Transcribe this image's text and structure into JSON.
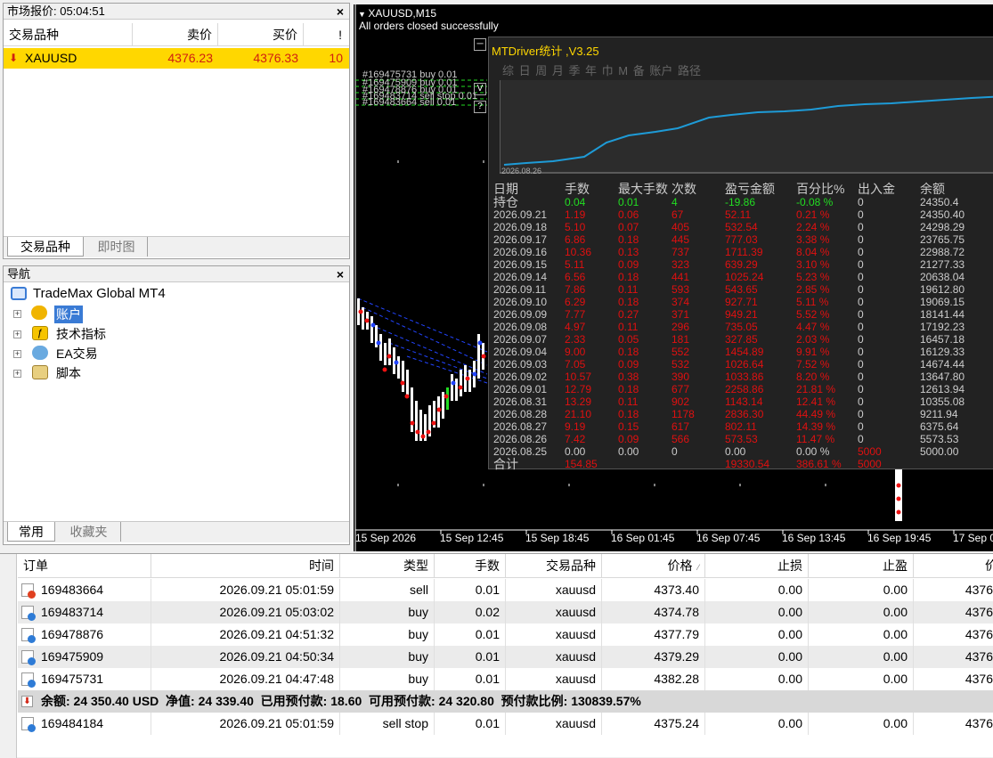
{
  "market_watch": {
    "title": "市场报价: 05:04:51",
    "close": "×",
    "columns": [
      "交易品种",
      "卖价",
      "买价",
      "!"
    ],
    "rows": [
      {
        "symbol": "XAUUSD",
        "bid": "4376.23",
        "ask": "4376.33",
        "spread": "10"
      }
    ],
    "tabs": [
      "交易品种",
      "即时图"
    ]
  },
  "navigator": {
    "title": "导航",
    "close": "×",
    "root": "TradeMax Global MT4",
    "items": [
      "账户",
      "技术指标",
      "EA交易",
      "脚本"
    ],
    "tabs": [
      "常用",
      "收藏夹"
    ]
  },
  "chart": {
    "title": "XAUUSD,M15",
    "message": "All orders closed successfully",
    "order_lines": [
      "#169475731 buy 0.01",
      "#169475909 buy 0.01",
      "#169478876 buy 0.01",
      "#169483714 sell stop 0.01",
      "#169483664 sell 0.01"
    ],
    "x_labels": [
      "15 Sep 2026",
      "15 Sep 12:45",
      "15 Sep 18:45",
      "16 Sep 01:45",
      "16 Sep 07:45",
      "16 Sep 13:45",
      "16 Sep 19:45",
      "17 Sep 0"
    ],
    "side_buttons": [
      "─",
      "V",
      "?"
    ]
  },
  "stats": {
    "title": "MTDriver统计 ,V3.25",
    "tabs": "综 日 周 月 季 年 巾 M 备 账户          路径",
    "graph_date": "2026.08.26",
    "columns": [
      "日期",
      "手数",
      "最大手数",
      "次数",
      "盈亏金额",
      "百分比%",
      "出入金",
      "余额"
    ],
    "holding": {
      "date": "持仓",
      "lots": "0.04",
      "max": "0.01",
      "count": "4",
      "pl": "-19.86",
      "pct": "-0.08 %",
      "io": "0",
      "bal": "24350.4"
    },
    "rows": [
      {
        "date": "2026.09.21",
        "lots": "1.19",
        "max": "0.06",
        "count": "67",
        "pl": "52.11",
        "pct": "0.21 %",
        "io": "0",
        "bal": "24350.40"
      },
      {
        "date": "2026.09.18",
        "lots": "5.10",
        "max": "0.07",
        "count": "405",
        "pl": "532.54",
        "pct": "2.24 %",
        "io": "0",
        "bal": "24298.29"
      },
      {
        "date": "2026.09.17",
        "lots": "6.86",
        "max": "0.18",
        "count": "445",
        "pl": "777.03",
        "pct": "3.38 %",
        "io": "0",
        "bal": "23765.75"
      },
      {
        "date": "2026.09.16",
        "lots": "10.36",
        "max": "0.13",
        "count": "737",
        "pl": "1711.39",
        "pct": "8.04 %",
        "io": "0",
        "bal": "22988.72"
      },
      {
        "date": "2026.09.15",
        "lots": "5.11",
        "max": "0.09",
        "count": "323",
        "pl": "639.29",
        "pct": "3.10 %",
        "io": "0",
        "bal": "21277.33"
      },
      {
        "date": "2026.09.14",
        "lots": "6.56",
        "max": "0.18",
        "count": "441",
        "pl": "1025.24",
        "pct": "5.23 %",
        "io": "0",
        "bal": "20638.04"
      },
      {
        "date": "2026.09.11",
        "lots": "7.86",
        "max": "0.11",
        "count": "593",
        "pl": "543.65",
        "pct": "2.85 %",
        "io": "0",
        "bal": "19612.80"
      },
      {
        "date": "2026.09.10",
        "lots": "6.29",
        "max": "0.18",
        "count": "374",
        "pl": "927.71",
        "pct": "5.11 %",
        "io": "0",
        "bal": "19069.15"
      },
      {
        "date": "2026.09.09",
        "lots": "7.77",
        "max": "0.27",
        "count": "371",
        "pl": "949.21",
        "pct": "5.52 %",
        "io": "0",
        "bal": "18141.44"
      },
      {
        "date": "2026.09.08",
        "lots": "4.97",
        "max": "0.11",
        "count": "296",
        "pl": "735.05",
        "pct": "4.47 %",
        "io": "0",
        "bal": "17192.23"
      },
      {
        "date": "2026.09.07",
        "lots": "2.33",
        "max": "0.05",
        "count": "181",
        "pl": "327.85",
        "pct": "2.03 %",
        "io": "0",
        "bal": "16457.18"
      },
      {
        "date": "2026.09.04",
        "lots": "9.00",
        "max": "0.18",
        "count": "552",
        "pl": "1454.89",
        "pct": "9.91 %",
        "io": "0",
        "bal": "16129.33"
      },
      {
        "date": "2026.09.03",
        "lots": "7.05",
        "max": "0.09",
        "count": "532",
        "pl": "1026.64",
        "pct": "7.52 %",
        "io": "0",
        "bal": "14674.44"
      },
      {
        "date": "2026.09.02",
        "lots": "10.57",
        "max": "0.38",
        "count": "390",
        "pl": "1033.86",
        "pct": "8.20 %",
        "io": "0",
        "bal": "13647.80"
      },
      {
        "date": "2026.09.01",
        "lots": "12.79",
        "max": "0.18",
        "count": "677",
        "pl": "2258.86",
        "pct": "21.81 %",
        "io": "0",
        "bal": "12613.94"
      },
      {
        "date": "2026.08.31",
        "lots": "13.29",
        "max": "0.11",
        "count": "902",
        "pl": "1143.14",
        "pct": "12.41 %",
        "io": "0",
        "bal": "10355.08"
      },
      {
        "date": "2026.08.28",
        "lots": "21.10",
        "max": "0.18",
        "count": "1178",
        "pl": "2836.30",
        "pct": "44.49 %",
        "io": "0",
        "bal": "9211.94"
      },
      {
        "date": "2026.08.27",
        "lots": "9.19",
        "max": "0.15",
        "count": "617",
        "pl": "802.11",
        "pct": "14.39 %",
        "io": "0",
        "bal": "6375.64"
      },
      {
        "date": "2026.08.26",
        "lots": "7.42",
        "max": "0.09",
        "count": "566",
        "pl": "573.53",
        "pct": "11.47 %",
        "io": "0",
        "bal": "5573.53"
      },
      {
        "date": "2026.08.25",
        "lots": "0.00",
        "max": "0.00",
        "count": "0",
        "pl": "0.00",
        "pct": "0.00 %",
        "io": "5000",
        "bal": "5000.00"
      }
    ],
    "total": {
      "date": "合计",
      "lots": "154.85",
      "pl": "19330.54",
      "pct": "386.61 %",
      "io": "5000"
    }
  },
  "terminal": {
    "close": "×",
    "columns": [
      "订单",
      "时间",
      "类型",
      "手数",
      "交易品种",
      "价格",
      "止损",
      "止盈",
      "价"
    ],
    "orders": [
      {
        "id": "169483664",
        "time": "2026.09.21 05:01:59",
        "type": "sell",
        "lots": "0.01",
        "symbol": "xauusd",
        "price": "4373.40",
        "sl": "0.00",
        "tp": "0.00",
        "cur": "4376"
      },
      {
        "id": "169483714",
        "time": "2026.09.21 05:03:02",
        "type": "buy",
        "lots": "0.02",
        "symbol": "xauusd",
        "price": "4374.78",
        "sl": "0.00",
        "tp": "0.00",
        "cur": "4376"
      },
      {
        "id": "169478876",
        "time": "2026.09.21 04:51:32",
        "type": "buy",
        "lots": "0.01",
        "symbol": "xauusd",
        "price": "4377.79",
        "sl": "0.00",
        "tp": "0.00",
        "cur": "4376"
      },
      {
        "id": "169475909",
        "time": "2026.09.21 04:50:34",
        "type": "buy",
        "lots": "0.01",
        "symbol": "xauusd",
        "price": "4379.29",
        "sl": "0.00",
        "tp": "0.00",
        "cur": "4376"
      },
      {
        "id": "169475731",
        "time": "2026.09.21 04:47:48",
        "type": "buy",
        "lots": "0.01",
        "symbol": "xauusd",
        "price": "4382.28",
        "sl": "0.00",
        "tp": "0.00",
        "cur": "4376"
      }
    ],
    "summary": "余额: 24 350.40 USD  净值: 24 339.40  已用预付款: 18.60  可用预付款: 24 320.80  预付款比例: 130839.57%",
    "pending": {
      "id": "169484184",
      "time": "2026.09.21 05:01:59",
      "type": "sell stop",
      "lots": "0.01",
      "symbol": "xauusd",
      "price": "4375.24",
      "sl": "0.00",
      "tp": "0.00",
      "cur": "4376"
    }
  },
  "colors": {
    "highlight": "#ffd700",
    "red": "#e01010",
    "graph_line": "#1e9bd7",
    "green": "#22dd22"
  }
}
